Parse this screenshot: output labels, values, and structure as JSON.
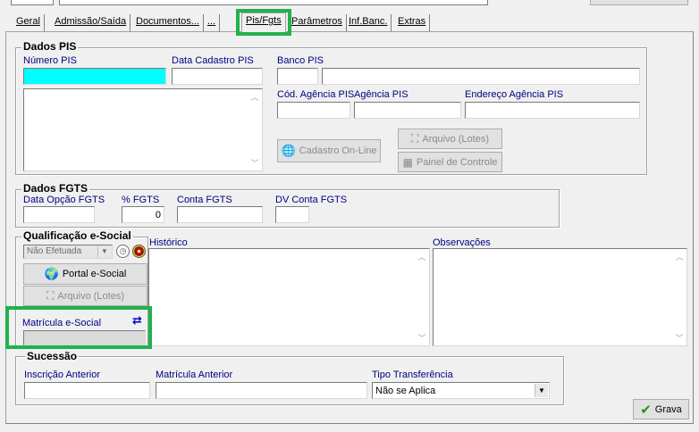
{
  "tabs": [
    {
      "label": "Geral"
    },
    {
      "label": "Admissão/Saída"
    },
    {
      "label": "Documentos..."
    },
    {
      "label": "..."
    },
    {
      "label": "Pis/Fgts"
    },
    {
      "label": "Parâmetros"
    },
    {
      "label": "Inf.Banc."
    },
    {
      "label": "Extras"
    }
  ],
  "dados_pis": {
    "title": "Dados PIS",
    "numero_pis_label": "Número PIS",
    "numero_pis_value": "",
    "data_cadastro_label": "Data Cadastro PIS",
    "data_cadastro_value": "",
    "banco_label": "Banco PIS",
    "cod_agencia_label": "Cód. Agência PIS",
    "agencia_label": "Agência PIS",
    "endereco_agencia_label": "Endereço Agência PIS",
    "cadastro_online_button": "Cadastro On-Line",
    "arquivo_lotes_button": "Arquivo (Lotes)",
    "painel_controle_button": "Painel de Controle"
  },
  "dados_fgts": {
    "title": "Dados FGTS",
    "data_opcao_label": "Data Opção FGTS",
    "percent_label": "% FGTS",
    "percent_value": "0",
    "conta_label": "Conta FGTS",
    "dv_conta_label": "DV Conta FGTS"
  },
  "esocial": {
    "title": "Qualificação e-Social",
    "status_value": "Não Efetuada",
    "portal_button": "Portal e-Social",
    "arquivo_button": "Arquivo (Lotes)",
    "matricula_label": "Matrícula e-Social",
    "historico_label": "Histórico",
    "observacoes_label": "Observações"
  },
  "sucessao": {
    "title": "Sucessão",
    "inscricao_label": "Inscrição Anterior",
    "matricula_label": "Matrícula Anterior",
    "tipo_label": "Tipo Transferência",
    "tipo_value": "Não se Aplica"
  },
  "grava_button": "Grava",
  "colors": {
    "highlight": "#22b14c",
    "cyan_field": "#00ffff",
    "label_blue": "#000080"
  }
}
